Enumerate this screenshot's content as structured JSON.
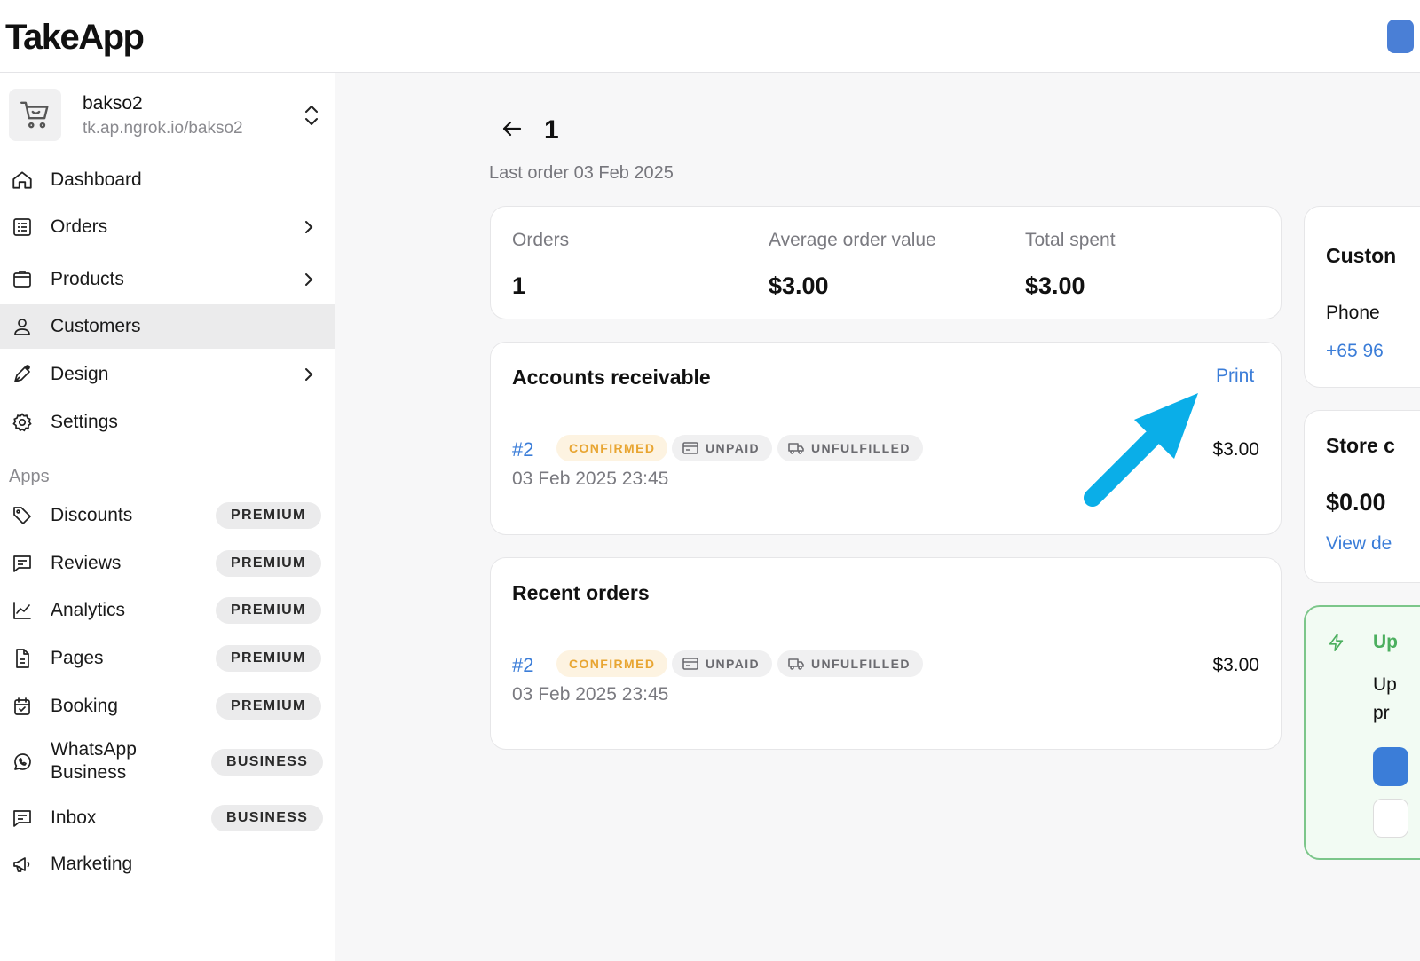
{
  "header": {
    "logo": "TakeApp"
  },
  "store": {
    "name": "bakso2",
    "url": "tk.ap.ngrok.io/bakso2"
  },
  "nav": {
    "dashboard": "Dashboard",
    "orders": "Orders",
    "products": "Products",
    "customers": "Customers",
    "design": "Design",
    "settings": "Settings"
  },
  "apps": {
    "heading": "Apps",
    "items": [
      {
        "label": "Discounts",
        "badge": "PREMIUM"
      },
      {
        "label": "Reviews",
        "badge": "PREMIUM"
      },
      {
        "label": "Analytics",
        "badge": "PREMIUM"
      },
      {
        "label": "Pages",
        "badge": "PREMIUM"
      },
      {
        "label": "Booking",
        "badge": "PREMIUM"
      },
      {
        "label_line1": "WhatsApp",
        "label_line2": "Business",
        "badge": "BUSINESS"
      },
      {
        "label": "Inbox",
        "badge": "BUSINESS"
      },
      {
        "label": "Marketing"
      }
    ]
  },
  "page": {
    "title": "1",
    "subtitle": "Last order 03 Feb 2025"
  },
  "stats": {
    "orders_label": "Orders",
    "orders_value": "1",
    "aov_label": "Average order value",
    "aov_value": "$3.00",
    "total_label": "Total spent",
    "total_value": "$3.00"
  },
  "receivable": {
    "title": "Accounts receivable",
    "print_label": "Print",
    "order": {
      "number": "#2",
      "status": "CONFIRMED",
      "payment": "UNPAID",
      "fulfillment": "UNFULFILLED",
      "date": "03 Feb 2025 23:45",
      "amount": "$3.00"
    }
  },
  "recent": {
    "title": "Recent orders",
    "order": {
      "number": "#2",
      "status": "CONFIRMED",
      "payment": "UNPAID",
      "fulfillment": "UNFULFILLED",
      "date": "03 Feb 2025 23:45",
      "amount": "$3.00"
    }
  },
  "customer_card": {
    "title": "Custon",
    "phone_label": "Phone",
    "phone_value": "+65 96"
  },
  "store_credit_card": {
    "title": "Store c",
    "value": "$0.00",
    "link": "View de"
  },
  "upgrade_card": {
    "title": "Up",
    "line1": "Up",
    "line2": "pr"
  },
  "colors": {
    "accent": "#3b7dd8",
    "annotation_arrow": "#0aaee8",
    "confirmed_text": "#e8a531",
    "upgrade_border": "#7cc68a"
  }
}
